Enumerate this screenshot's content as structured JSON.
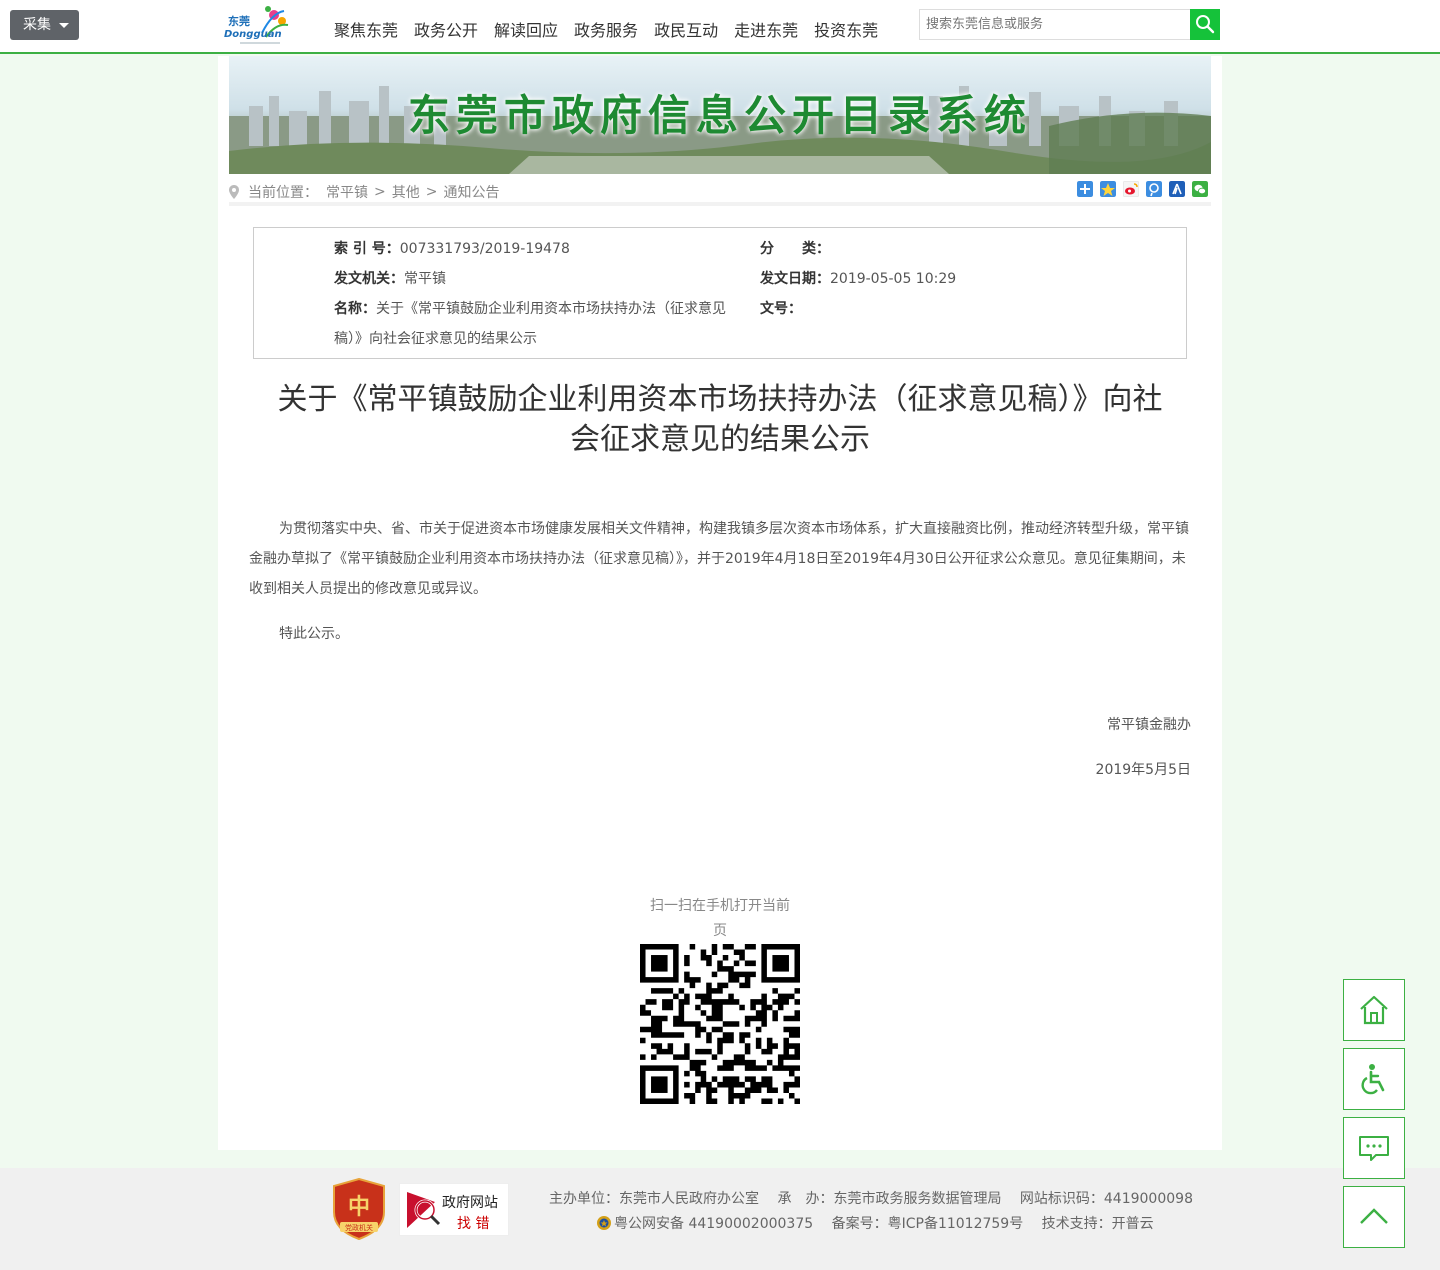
{
  "topbar": {
    "caiji_label": "采集",
    "logo_alt": "东莞 Dongguan CHINA",
    "nav": [
      "聚焦东莞",
      "政务公开",
      "解读回应",
      "政务服务",
      "政民互动",
      "走进东莞",
      "投资东莞"
    ],
    "search_placeholder": "搜索东莞信息或服务"
  },
  "banner": {
    "title": "东莞市政府信息公开目录系统"
  },
  "breadcrumb": {
    "prefix": "当前位置：",
    "items": [
      "常平镇",
      "其他",
      "通知公告"
    ],
    "sep": ">"
  },
  "meta": {
    "index_label": "索 引 号：",
    "index_value": "007331793/2019-19478",
    "category_label": "分　　类：",
    "category_value": "",
    "issuer_label": "发文机关：",
    "issuer_value": "常平镇",
    "date_label": "发文日期：",
    "date_value": "2019-05-05 10:29",
    "name_label": "名称：",
    "name_value_line1": "关于《常平镇鼓励企业利用资本市场扶持办法（征求意见",
    "name_value_line2": "稿）》向社会征求意见的结果公示",
    "docno_label": "文号：",
    "docno_value": ""
  },
  "article": {
    "title_line1": "关于《常平镇鼓励企业利用资本市场扶持办法（征求意见稿）》向社",
    "title_line2": "会征求意见的结果公示",
    "para1": "为贯彻落实中央、省、市关于促进资本市场健康发展相关文件精神，构建我镇多层次资本市场体系，扩大直接融资比例，推动经济转型升级，常平镇金融办草拟了《常平镇鼓励企业利用资本市场扶持办法（征求意见稿）》，并于2019年4月18日至2019年4月30日公开征求公众意见。意见征集期间，未收到相关人员提出的修改意见或异议。",
    "para2": "特此公示。",
    "signer": "常平镇金融办",
    "sign_date": "2019年5月5日"
  },
  "qr": {
    "caption_line1": "扫一扫在手机打开当前",
    "caption_line2": "页"
  },
  "footer": {
    "badge1_text": "党政机关",
    "badge2_line1": "政府网站",
    "badge2_line2": "找 错",
    "line1": "主办单位：东莞市人民政府办公室　 承　办：东莞市政务服务数据管理局　 网站标识码：4419000098",
    "line2_police": "粤公网安备 44190002000375",
    "line2_rest": "　 备案号：粤ICP备11012759号　 技术支持：开普云"
  },
  "tools": [
    "home-icon",
    "accessibility-icon",
    "message-icon",
    "back-to-top-icon"
  ],
  "colors": {
    "accent": "#3cb043",
    "search_btn": "#15c23a",
    "banner_title": "#1e8a32"
  }
}
